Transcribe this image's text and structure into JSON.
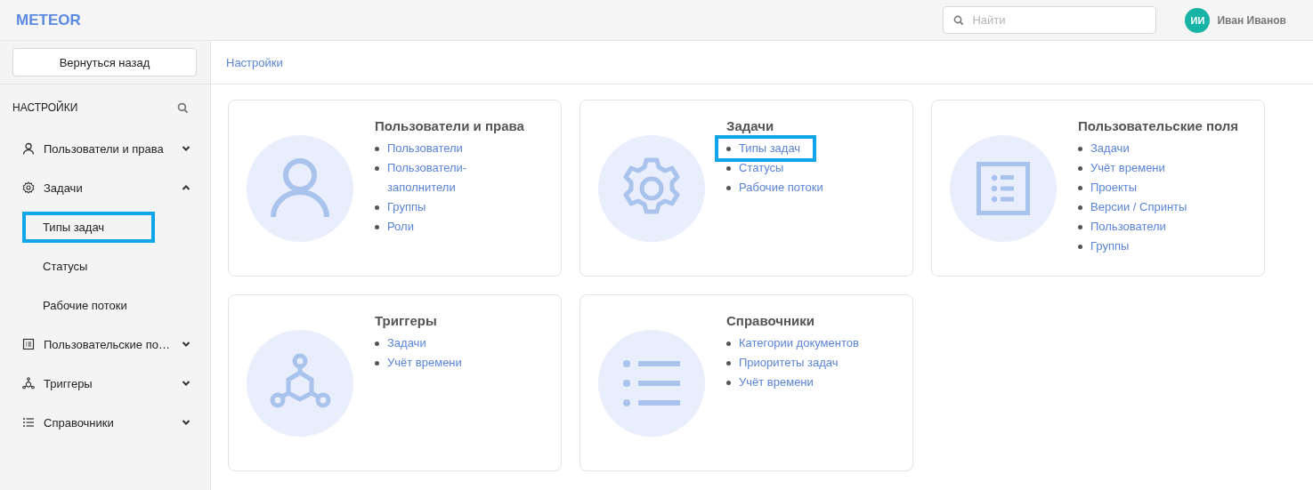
{
  "header": {
    "logo": "METEOR",
    "search": {
      "placeholder": "Найти"
    },
    "user": {
      "initials": "ИИ",
      "name": "Иван Иванов"
    }
  },
  "sidebar": {
    "back_button": "Вернуться назад",
    "title": "НАСТРОЙКИ",
    "items": [
      {
        "label": "Пользователи и права",
        "expanded": false
      },
      {
        "label": "Задачи",
        "expanded": true,
        "children": [
          {
            "label": "Типы задач",
            "highlighted": true
          },
          {
            "label": "Статусы",
            "highlighted": false
          },
          {
            "label": "Рабочие потоки",
            "highlighted": false
          }
        ]
      },
      {
        "label": "Пользовательские по…",
        "expanded": false
      },
      {
        "label": "Триггеры",
        "expanded": false
      },
      {
        "label": "Справочники",
        "expanded": false
      }
    ]
  },
  "breadcrumb": "Настройки",
  "cards": [
    {
      "title": "Пользователи и права",
      "links": [
        {
          "label": "Пользователи",
          "highlighted": false
        },
        {
          "label": "Пользователи-заполнители",
          "highlighted": false
        },
        {
          "label": "Группы",
          "highlighted": false
        },
        {
          "label": "Роли",
          "highlighted": false
        }
      ]
    },
    {
      "title": "Задачи",
      "links": [
        {
          "label": "Типы задач",
          "highlighted": true
        },
        {
          "label": "Статусы",
          "highlighted": false
        },
        {
          "label": "Рабочие потоки",
          "highlighted": false
        }
      ]
    },
    {
      "title": "Пользовательские поля",
      "links": [
        {
          "label": "Задачи",
          "highlighted": false
        },
        {
          "label": "Учёт времени",
          "highlighted": false
        },
        {
          "label": "Проекты",
          "highlighted": false
        },
        {
          "label": "Версии / Спринты",
          "highlighted": false
        },
        {
          "label": "Пользователи",
          "highlighted": false
        },
        {
          "label": "Группы",
          "highlighted": false
        }
      ]
    },
    {
      "title": "Триггеры",
      "links": [
        {
          "label": "Задачи",
          "highlighted": false
        },
        {
          "label": "Учёт времени",
          "highlighted": false
        }
      ]
    },
    {
      "title": "Справочники",
      "links": [
        {
          "label": "Категории документов",
          "highlighted": false
        },
        {
          "label": "Приоритеты задач",
          "highlighted": false
        },
        {
          "label": "Учёт времени",
          "highlighted": false
        }
      ]
    }
  ]
}
